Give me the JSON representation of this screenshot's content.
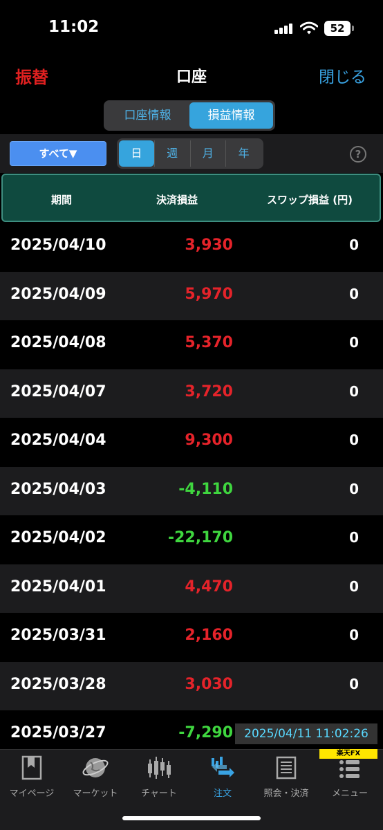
{
  "status": {
    "time": "11:02",
    "battery": "52"
  },
  "nav": {
    "left": "振替",
    "title": "口座",
    "right": "閉じる"
  },
  "top_tabs": [
    {
      "label": "口座情報",
      "active": false
    },
    {
      "label": "損益情報",
      "active": true
    }
  ],
  "filter": {
    "select_label": "すべて▼",
    "help": "?"
  },
  "period_tabs": [
    {
      "label": "日",
      "active": true
    },
    {
      "label": "週",
      "active": false
    },
    {
      "label": "月",
      "active": false
    },
    {
      "label": "年",
      "active": false
    }
  ],
  "table": {
    "headers": [
      "期間",
      "決済損益",
      "スワップ損益 (円)"
    ],
    "rows": [
      {
        "date": "2025/04/10",
        "pl": "3,930",
        "swap": "0"
      },
      {
        "date": "2025/04/09",
        "pl": "5,970",
        "swap": "0"
      },
      {
        "date": "2025/04/08",
        "pl": "5,370",
        "swap": "0"
      },
      {
        "date": "2025/04/07",
        "pl": "3,720",
        "swap": "0"
      },
      {
        "date": "2025/04/04",
        "pl": "9,300",
        "swap": "0"
      },
      {
        "date": "2025/04/03",
        "pl": "-4,110",
        "swap": "0"
      },
      {
        "date": "2025/04/02",
        "pl": "-22,170",
        "swap": "0"
      },
      {
        "date": "2025/04/01",
        "pl": "4,470",
        "swap": "0"
      },
      {
        "date": "2025/03/31",
        "pl": "2,160",
        "swap": "0"
      },
      {
        "date": "2025/03/28",
        "pl": "3,030",
        "swap": "0"
      },
      {
        "date": "2025/03/27",
        "pl": "-7,290",
        "swap": ""
      }
    ]
  },
  "timestamp": "2025/04/11 11:02:26",
  "brand": "楽天FX",
  "tabbar": [
    {
      "label": "マイページ",
      "icon": "bookmark-icon",
      "active": false
    },
    {
      "label": "マーケット",
      "icon": "globe-icon",
      "active": false
    },
    {
      "label": "チャート",
      "icon": "candlestick-icon",
      "active": false
    },
    {
      "label": "注文",
      "icon": "order-icon",
      "active": true
    },
    {
      "label": "照会・決済",
      "icon": "document-icon",
      "active": false
    },
    {
      "label": "メニュー",
      "icon": "list-icon",
      "active": false
    }
  ],
  "colors": {
    "profit": "#e5232a",
    "loss": "#3fd63f",
    "accent": "#36a4dd"
  }
}
